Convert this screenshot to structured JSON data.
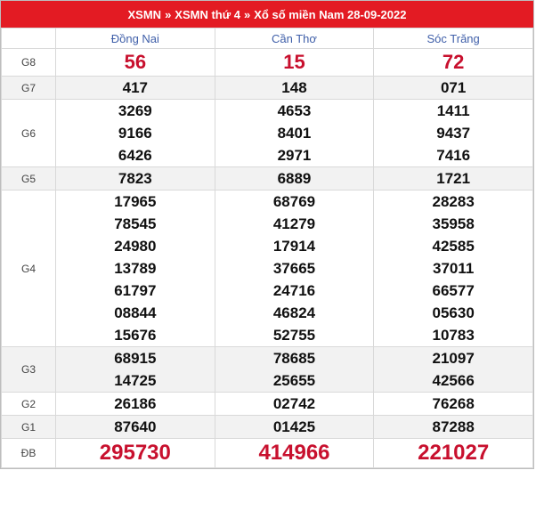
{
  "header": {
    "crumb1": "XSMN",
    "crumb2": "XSMN thứ 4",
    "crumb3": "Xổ số miền Nam 28-09-2022",
    "sep": "»"
  },
  "provinces": [
    "Đồng Nai",
    "Cần Thơ",
    "Sóc Trăng"
  ],
  "prizes": [
    {
      "label": "G8",
      "style": "big",
      "cells": [
        [
          "56"
        ],
        [
          "15"
        ],
        [
          "72"
        ]
      ]
    },
    {
      "label": "G7",
      "style": "num",
      "cells": [
        [
          "417"
        ],
        [
          "148"
        ],
        [
          "071"
        ]
      ]
    },
    {
      "label": "G6",
      "style": "num",
      "cells": [
        [
          "3269",
          "9166",
          "6426"
        ],
        [
          "4653",
          "8401",
          "2971"
        ],
        [
          "1411",
          "9437",
          "7416"
        ]
      ]
    },
    {
      "label": "G5",
      "style": "num",
      "cells": [
        [
          "7823"
        ],
        [
          "6889"
        ],
        [
          "1721"
        ]
      ]
    },
    {
      "label": "G4",
      "style": "num",
      "cells": [
        [
          "17965",
          "78545",
          "24980",
          "13789",
          "61797",
          "08844",
          "15676"
        ],
        [
          "68769",
          "41279",
          "17914",
          "37665",
          "24716",
          "46824",
          "52755"
        ],
        [
          "28283",
          "35958",
          "42585",
          "37011",
          "66577",
          "05630",
          "10783"
        ]
      ]
    },
    {
      "label": "G3",
      "style": "num",
      "cells": [
        [
          "68915",
          "14725"
        ],
        [
          "78685",
          "25655"
        ],
        [
          "21097",
          "42566"
        ]
      ]
    },
    {
      "label": "G2",
      "style": "num",
      "cells": [
        [
          "26186"
        ],
        [
          "02742"
        ],
        [
          "76268"
        ]
      ]
    },
    {
      "label": "G1",
      "style": "num",
      "cells": [
        [
          "87640"
        ],
        [
          "01425"
        ],
        [
          "87288"
        ]
      ]
    },
    {
      "label": "ĐB",
      "style": "db",
      "cells": [
        [
          "295730"
        ],
        [
          "414966"
        ],
        [
          "221027"
        ]
      ]
    }
  ],
  "colors": {
    "header_bg": "#e31b23",
    "highlight_number": "#c8102e",
    "province_text": "#3f5fa9",
    "row_shade": "#f2f2f2"
  }
}
